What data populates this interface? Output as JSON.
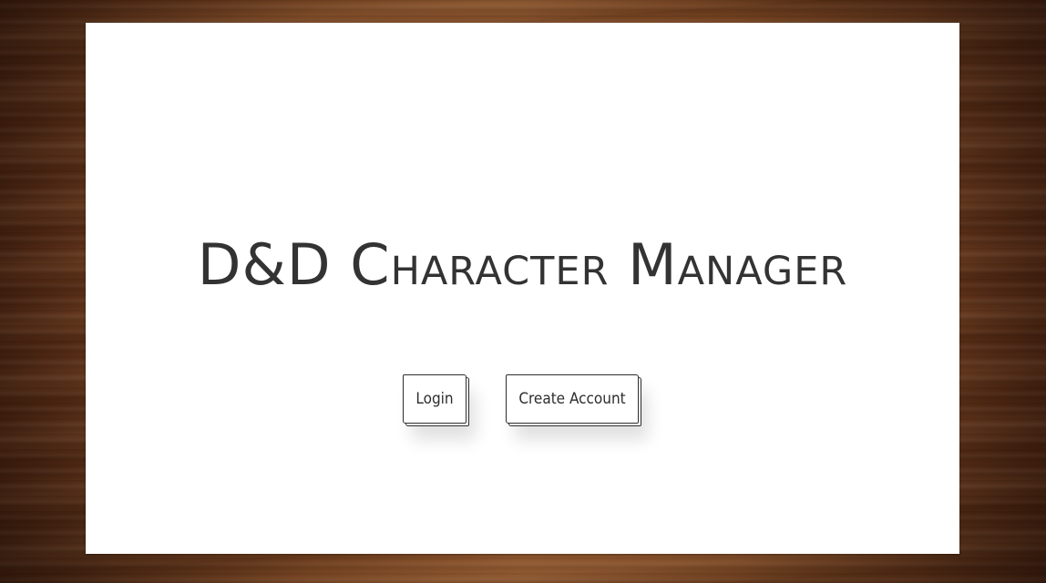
{
  "app": {
    "title": "D&D Character Manager"
  },
  "actions": {
    "login_label": "Login",
    "create_account_label": "Create Account"
  },
  "colors": {
    "paper": "#ffffff",
    "ink": "#333333",
    "desk_wood": "#8a5028"
  }
}
